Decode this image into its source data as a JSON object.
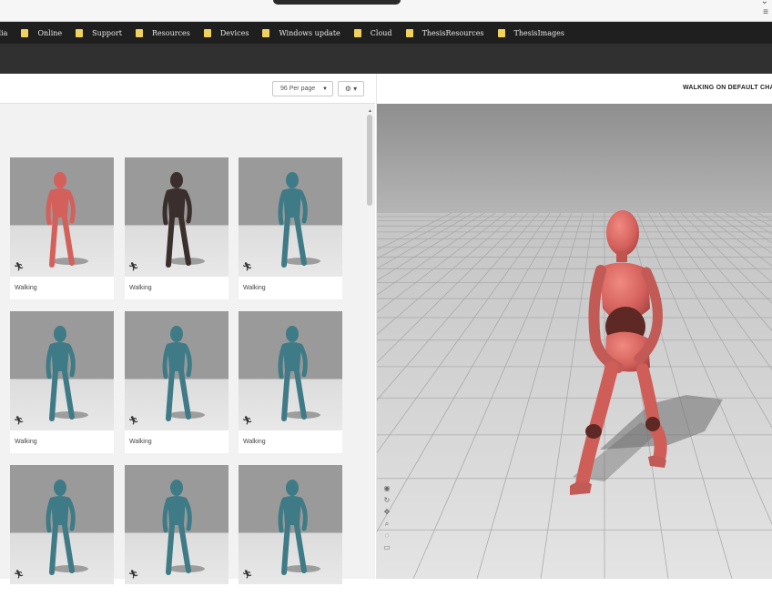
{
  "bookmarks": [
    {
      "label": "dia"
    },
    {
      "label": "Online"
    },
    {
      "label": "Support"
    },
    {
      "label": "Resources"
    },
    {
      "label": "Devices"
    },
    {
      "label": "Windows update"
    },
    {
      "label": "Cloud"
    },
    {
      "label": "ThesisResources"
    },
    {
      "label": "ThesisImages"
    }
  ],
  "toolbar": {
    "per_page": "96 Per page",
    "settings_icon": "gear-icon"
  },
  "viewer": {
    "title": "WALKING ON DEFAULT CHA"
  },
  "animations": [
    {
      "caption": "Walking",
      "character": "red-mannequin"
    },
    {
      "caption": "Walking",
      "character": "zombie"
    },
    {
      "caption": "Walking",
      "character": "teal-mannequin"
    },
    {
      "caption": "Walking",
      "character": "teal-mannequin"
    },
    {
      "caption": "Walking",
      "character": "teal-mannequin"
    },
    {
      "caption": "Walking",
      "character": "teal-mannequin"
    },
    {
      "caption": "",
      "character": "teal-mannequin"
    },
    {
      "caption": "",
      "character": "teal-mannequin"
    },
    {
      "caption": "",
      "character": "teal-mannequin"
    }
  ],
  "colors": {
    "bookmark_folder": "#f1d25e",
    "red_character": "#d4605c",
    "teal_character": "#3f7b86",
    "zombie_character": "#3a2f2c"
  }
}
